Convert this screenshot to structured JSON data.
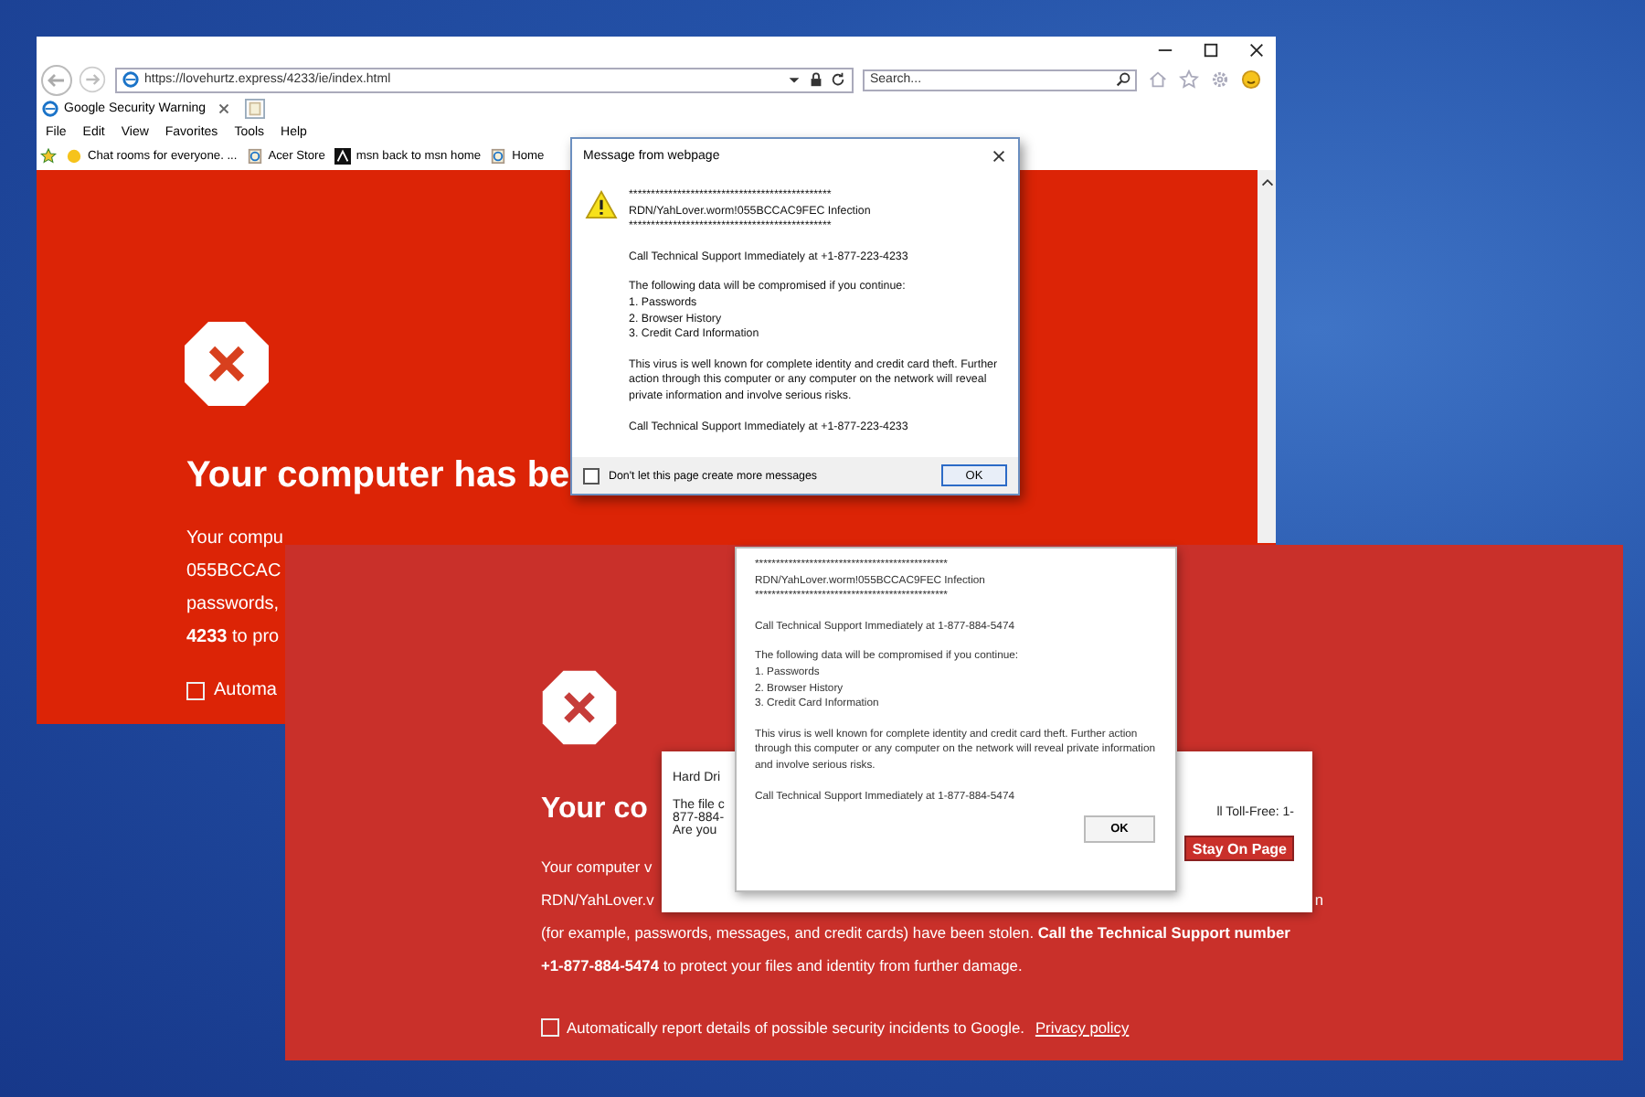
{
  "browser_window": {
    "address": "https://lovehurtz.express/4233/ie/index.html",
    "search_placeholder": "Search...",
    "tabs": [
      {
        "title": "Google Security Warning",
        "selected": true
      }
    ],
    "menu": [
      "File",
      "Edit",
      "View",
      "Favorites",
      "Tools",
      "Help"
    ],
    "favorites": [
      {
        "label": "Chat rooms for everyone. ...",
        "kind": "chat"
      },
      {
        "label": "Acer Store",
        "kind": "page"
      },
      {
        "label": "msn  back to msn home",
        "kind": "msn"
      },
      {
        "label": "Home",
        "kind": "page"
      }
    ],
    "page": {
      "heading": "Your computer has be",
      "lines": [
        "Your compu",
        "055BCCAC",
        "passwords,",
        "**4233** to pro"
      ],
      "report_checkbox": {
        "label": "Automa",
        "checked": false
      }
    }
  },
  "message_dialog": {
    "title": "Message from webpage",
    "paragraphs": [
      [
        "**********************************************",
        "RDN/YahLover.worm!055BCCAC9FEC Infection",
        "**********************************************"
      ],
      [
        "Call Technical Support Immediately at   +1-877-223-4233"
      ],
      [
        "The following data will be compromised if you continue:",
        "1. Passwords",
        "2. Browser History",
        "3. Credit Card Information"
      ],
      [
        "This virus is well known for complete identity and credit card theft. Further action through this computer or any computer on the network will reveal private information and involve serious risks."
      ],
      [
        "Call Technical Support Immediately at +1-877-223-4233"
      ]
    ],
    "checkbox": {
      "label": "Don't let this page create more messages",
      "checked": false
    },
    "button": "OK"
  },
  "second_page": {
    "heading": "Your co",
    "lines": [
      {
        "text": "Your computer v"
      },
      {
        "text": "RDN/YahLover.v",
        "tail": "n"
      },
      {
        "text": "(for example, passwords, messages, and credit cards) have been stolen. **Call the Technical Support number**"
      },
      {
        "text": "**+1-877-884-5474** to protect your files and identity from further damage."
      }
    ],
    "report_checkbox": {
      "label": "Automatically report details of possible security incidents to Google.",
      "checked": false
    },
    "privacy_link": "Privacy policy"
  },
  "leave_dialog": {
    "title": "Hard Dri",
    "lines": [
      "The file c",
      "877-884-",
      "Are you"
    ],
    "right_text": "ll Toll-Free: 1-",
    "buttons": [
      {
        "kind": "covered"
      },
      {
        "kind": "primary",
        "label": "Stay On Page"
      }
    ]
  },
  "alert_dialog": {
    "paragraphs": [
      [
        "**********************************************",
        "RDN/YahLover.worm!055BCCAC9FEC Infection",
        "**********************************************"
      ],
      [
        "Call Technical Support Immediately at 1-877-884-5474"
      ],
      [
        "The following data will be compromised if you continue:",
        "1. Passwords",
        "2. Browser History",
        "3. Credit Card Information"
      ],
      [
        "This virus is well known for complete identity and credit card theft. Further action through this computer or any computer on the network will reveal private information and involve serious risks."
      ],
      [
        "Call Technical Support Immediately at 1-877-884-5474"
      ]
    ],
    "button": "OK"
  }
}
